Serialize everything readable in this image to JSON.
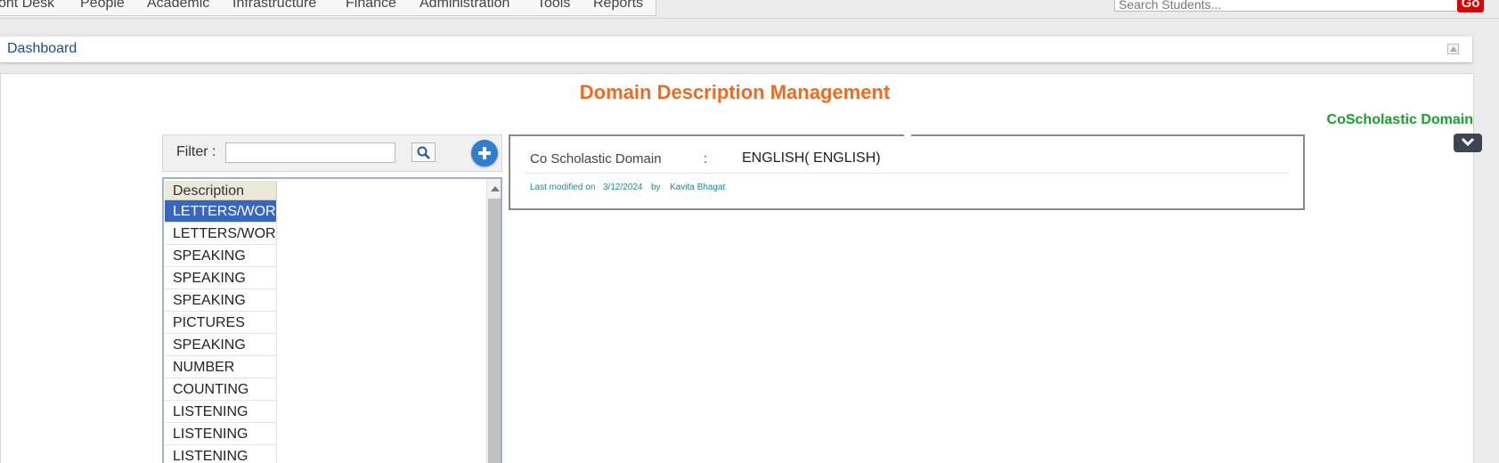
{
  "nav": {
    "items": [
      "ont Desk",
      "People",
      "Academic",
      "Infrastructure",
      "Finance",
      "Administration",
      "Tools",
      "Reports"
    ],
    "search_placeholder": "Search Students...",
    "go_label": "Go"
  },
  "breadcrumb": {
    "label": "Dashboard"
  },
  "page": {
    "title": "Domain Description Management",
    "domain_label": "CoScholastic Domain"
  },
  "filter": {
    "label": "Filter :",
    "value": ""
  },
  "grid": {
    "header": "Description",
    "selected_index": 0,
    "rows": [
      "LETTERS/WORDS",
      "LETTERS/WORDS",
      "SPEAKING",
      "SPEAKING",
      "SPEAKING",
      "PICTURES",
      "SPEAKING",
      "NUMBER",
      "COUNTING",
      "LISTENING",
      "LISTENING",
      "LISTENING"
    ]
  },
  "detail": {
    "field_label": "Co Scholastic Domain",
    "colon": ":",
    "field_value": "ENGLISH( ENGLISH)",
    "modified_prefix": "Last modified on",
    "modified_date": "3/12/2024",
    "modified_by_label": "by",
    "modified_by": "Kavita Bhagat"
  },
  "colors": {
    "title": "#f06a1e",
    "domain_label": "#17a02a",
    "selected_row": "#3665c2",
    "go_button": "#e00000",
    "add_button": "#2f7fd0"
  }
}
